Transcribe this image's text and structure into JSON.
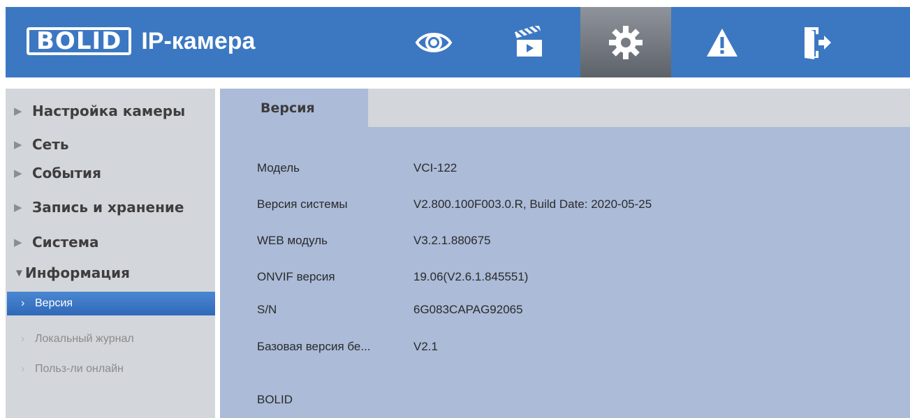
{
  "header": {
    "logo_brand": "BOLID",
    "logo_title": "IP-камера",
    "nav": [
      {
        "icon": "eye-icon",
        "name": "live-view"
      },
      {
        "icon": "clapperboard-icon",
        "name": "playback"
      },
      {
        "icon": "gear-icon",
        "name": "setup",
        "active": true
      },
      {
        "icon": "warning-icon",
        "name": "alarm"
      },
      {
        "icon": "logout-door-icon",
        "name": "logout"
      }
    ]
  },
  "sidebar": {
    "items": [
      {
        "label": "Настройка камеры"
      },
      {
        "label": "Сеть"
      },
      {
        "label": "События"
      },
      {
        "label": "Запись и хранение"
      },
      {
        "label": "Система"
      },
      {
        "label": "Информация",
        "expanded": true
      }
    ],
    "subitems": [
      {
        "label": "Версия",
        "active": true
      },
      {
        "label": "Локальный журнал"
      },
      {
        "label": "Польз-ли онлайн"
      }
    ]
  },
  "main": {
    "tab": "Версия",
    "rows": [
      {
        "key": "Модель",
        "value": "VCI-122"
      },
      {
        "key": "Версия системы",
        "value": "V2.800.100F003.0.R, Build Date: 2020-05-25"
      },
      {
        "key": "WEB модуль",
        "value": "V3.2.1.880675"
      },
      {
        "key": "ONVIF версия",
        "value": "19.06(V2.6.1.845551)"
      },
      {
        "key": "S/N",
        "value": "6G083CAPAG92065"
      },
      {
        "key": "Базовая версия бе...",
        "value": "V2.1"
      }
    ],
    "footer_brand": "BOLID"
  },
  "colors": {
    "header_bg": "#3c78c2",
    "sidebar_bg": "#d3d6da",
    "content_bg": "#abbbd8",
    "active_item": "#3a77c6"
  }
}
